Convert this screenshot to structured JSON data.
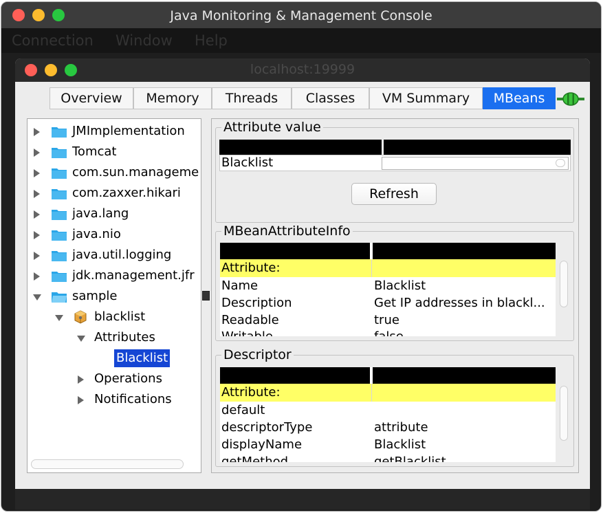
{
  "app": {
    "title": "Java Monitoring & Management Console"
  },
  "menu": [
    "Connection",
    "Window",
    "Help"
  ],
  "inner_window": {
    "title": "localhost:19999"
  },
  "tabs": [
    {
      "label": "Overview",
      "active": false
    },
    {
      "label": "Memory",
      "active": false
    },
    {
      "label": "Threads",
      "active": false
    },
    {
      "label": "Classes",
      "active": false
    },
    {
      "label": "VM Summary",
      "active": false
    },
    {
      "label": "MBeans",
      "active": true
    }
  ],
  "tree": {
    "nodes": [
      {
        "label": "JMImplementation",
        "icon": "folder-icon",
        "state": "collapsed"
      },
      {
        "label": "Tomcat",
        "icon": "folder-icon",
        "state": "collapsed"
      },
      {
        "label": "com.sun.manageme",
        "icon": "folder-icon",
        "state": "collapsed"
      },
      {
        "label": "com.zaxxer.hikari",
        "icon": "folder-icon",
        "state": "collapsed"
      },
      {
        "label": "java.lang",
        "icon": "folder-icon",
        "state": "collapsed"
      },
      {
        "label": "java.nio",
        "icon": "folder-icon",
        "state": "collapsed"
      },
      {
        "label": "java.util.logging",
        "icon": "folder-icon",
        "state": "collapsed"
      },
      {
        "label": "jdk.management.jfr",
        "icon": "folder-icon",
        "state": "collapsed"
      },
      {
        "label": "sample",
        "icon": "folder-icon",
        "state": "expanded"
      },
      {
        "label": "blacklist",
        "icon": "bean-icon",
        "state": "expanded"
      },
      {
        "label": "Attributes",
        "state": "expanded"
      },
      {
        "label": "Blacklist",
        "state": "selected"
      },
      {
        "label": "Operations",
        "state": "collapsed"
      },
      {
        "label": "Notifications",
        "state": "collapsed"
      }
    ]
  },
  "attribute_value": {
    "legend": "Attribute value",
    "row_label": "Blacklist",
    "value": "",
    "refresh_label": "Refresh"
  },
  "attribute_info": {
    "legend": "MBeanAttributeInfo",
    "header": "Attribute:",
    "rows": [
      {
        "name": "Name",
        "value": "Blacklist"
      },
      {
        "name": "Description",
        "value": "Get IP addresses in blackl..."
      },
      {
        "name": "Readable",
        "value": "true"
      },
      {
        "name": "Writable",
        "value": "false"
      }
    ]
  },
  "descriptor": {
    "legend": "Descriptor",
    "header": "Attribute:",
    "rows": [
      {
        "name": "default",
        "value": ""
      },
      {
        "name": "descriptorType",
        "value": "attribute"
      },
      {
        "name": "displayName",
        "value": "Blacklist"
      },
      {
        "name": "getMethod",
        "value": "getBlacklist"
      }
    ]
  },
  "colors": {
    "accent": "#1a6ff0",
    "selection": "#1546d4",
    "header_highlight": "#ffff66",
    "folder": "#2aa6e8"
  }
}
